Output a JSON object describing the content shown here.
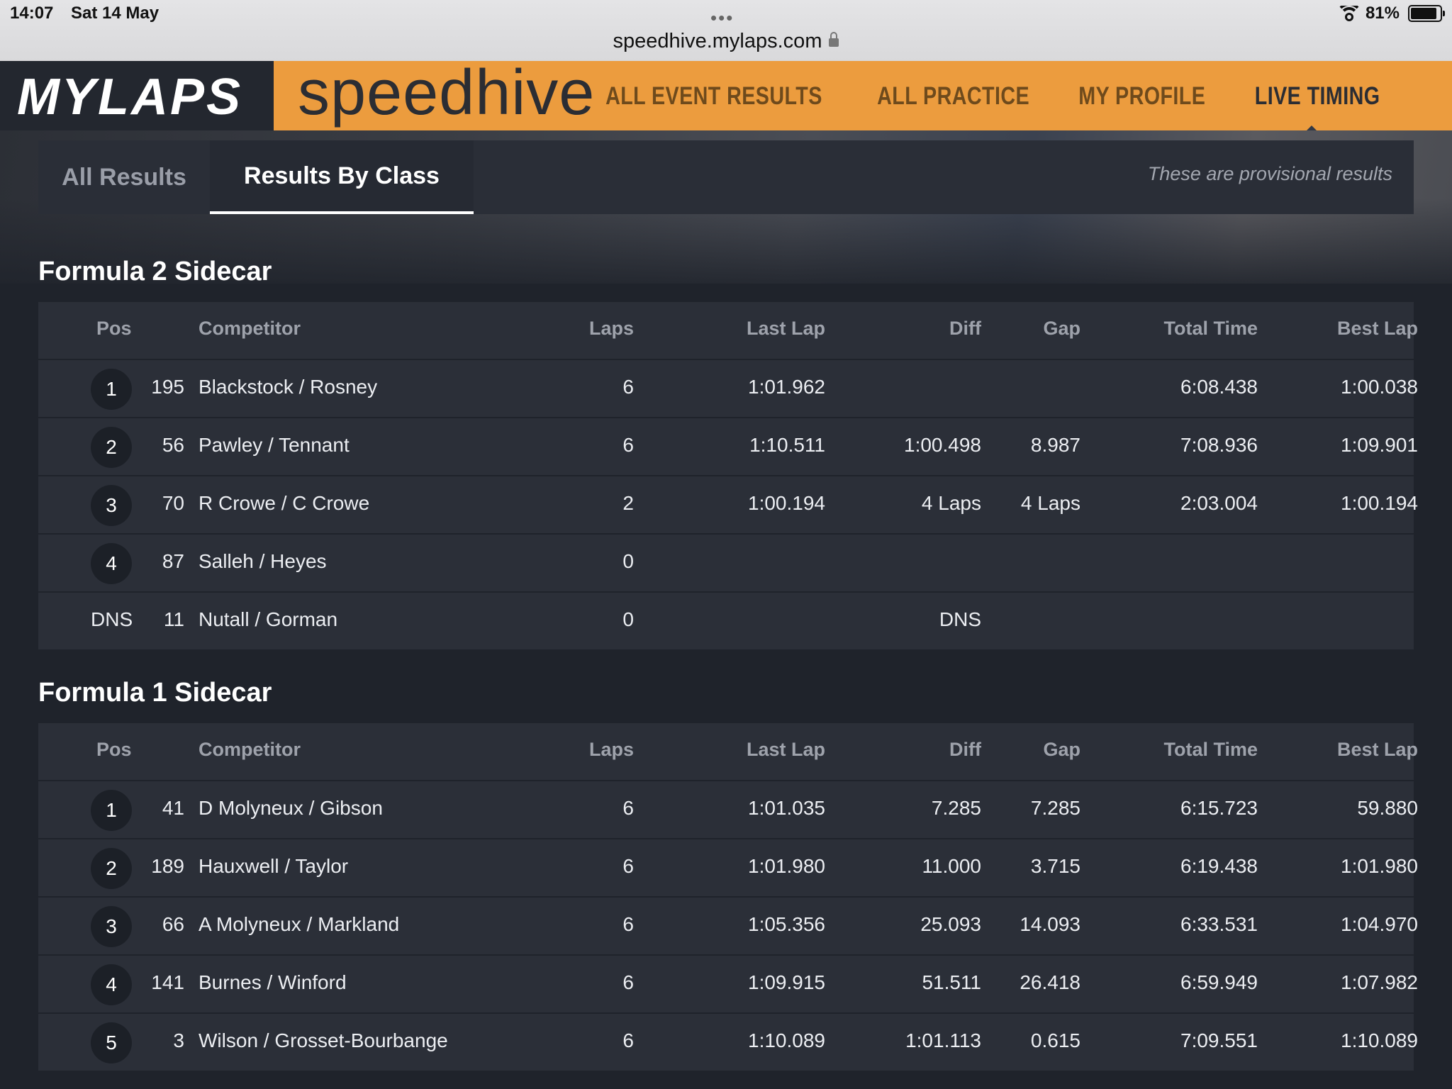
{
  "statusbar": {
    "time": "14:07",
    "date": "Sat 14 May",
    "url": "speedhive.mylaps.com",
    "battery": "81%",
    "dots": "•••"
  },
  "header": {
    "logo": "MYLAPS",
    "brand": "speedhive",
    "nav": [
      "ALL EVENT RESULTS",
      "ALL PRACTICE",
      "MY PROFILE",
      "LIVE TIMING"
    ],
    "active_nav": "LIVE TIMING",
    "accent_color": "#ec9c3e"
  },
  "tabs": {
    "all": "All Results",
    "by_class": "Results By Class",
    "note": "These are provisional results"
  },
  "columns": {
    "pos": "Pos",
    "competitor": "Competitor",
    "laps": "Laps",
    "last_lap": "Last Lap",
    "diff": "Diff",
    "gap": "Gap",
    "total_time": "Total Time",
    "best_lap": "Best Lap"
  },
  "sections": [
    {
      "title": "Formula 2 Sidecar",
      "rows": [
        {
          "pos": "1",
          "num": "195",
          "competitor": "Blackstock / Rosney",
          "laps": "6",
          "last": "1:01.962",
          "diff": "",
          "gap": "",
          "total": "6:08.438",
          "best": "1:00.038"
        },
        {
          "pos": "2",
          "num": "56",
          "competitor": "Pawley / Tennant",
          "laps": "6",
          "last": "1:10.511",
          "diff": "1:00.498",
          "gap": "8.987",
          "total": "7:08.936",
          "best": "1:09.901"
        },
        {
          "pos": "3",
          "num": "70",
          "competitor": "R Crowe / C Crowe",
          "laps": "2",
          "last": "1:00.194",
          "diff": "4 Laps",
          "gap": "4 Laps",
          "total": "2:03.004",
          "best": "1:00.194"
        },
        {
          "pos": "4",
          "num": "87",
          "competitor": "Salleh / Heyes",
          "laps": "0",
          "last": "",
          "diff": "",
          "gap": "",
          "total": "",
          "best": ""
        },
        {
          "pos": "DNS",
          "num": "11",
          "competitor": "Nutall / Gorman",
          "laps": "0",
          "last": "",
          "diff": "DNS",
          "gap": "",
          "total": "",
          "best": ""
        }
      ]
    },
    {
      "title": "Formula 1 Sidecar",
      "rows": [
        {
          "pos": "1",
          "num": "41",
          "competitor": "D Molyneux / Gibson",
          "laps": "6",
          "last": "1:01.035",
          "diff": "7.285",
          "gap": "7.285",
          "total": "6:15.723",
          "best": "59.880"
        },
        {
          "pos": "2",
          "num": "189",
          "competitor": "Hauxwell / Taylor",
          "laps": "6",
          "last": "1:01.980",
          "diff": "11.000",
          "gap": "3.715",
          "total": "6:19.438",
          "best": "1:01.980"
        },
        {
          "pos": "3",
          "num": "66",
          "competitor": "A Molyneux / Markland",
          "laps": "6",
          "last": "1:05.356",
          "diff": "25.093",
          "gap": "14.093",
          "total": "6:33.531",
          "best": "1:04.970"
        },
        {
          "pos": "4",
          "num": "141",
          "competitor": "Burnes / Winford",
          "laps": "6",
          "last": "1:09.915",
          "diff": "51.511",
          "gap": "26.418",
          "total": "6:59.949",
          "best": "1:07.982"
        },
        {
          "pos": "5",
          "num": "3",
          "competitor": "Wilson / Grosset-Bourbange",
          "laps": "6",
          "last": "1:10.089",
          "diff": "1:01.113",
          "gap": "0.615",
          "total": "7:09.551",
          "best": "1:10.089"
        }
      ]
    }
  ]
}
